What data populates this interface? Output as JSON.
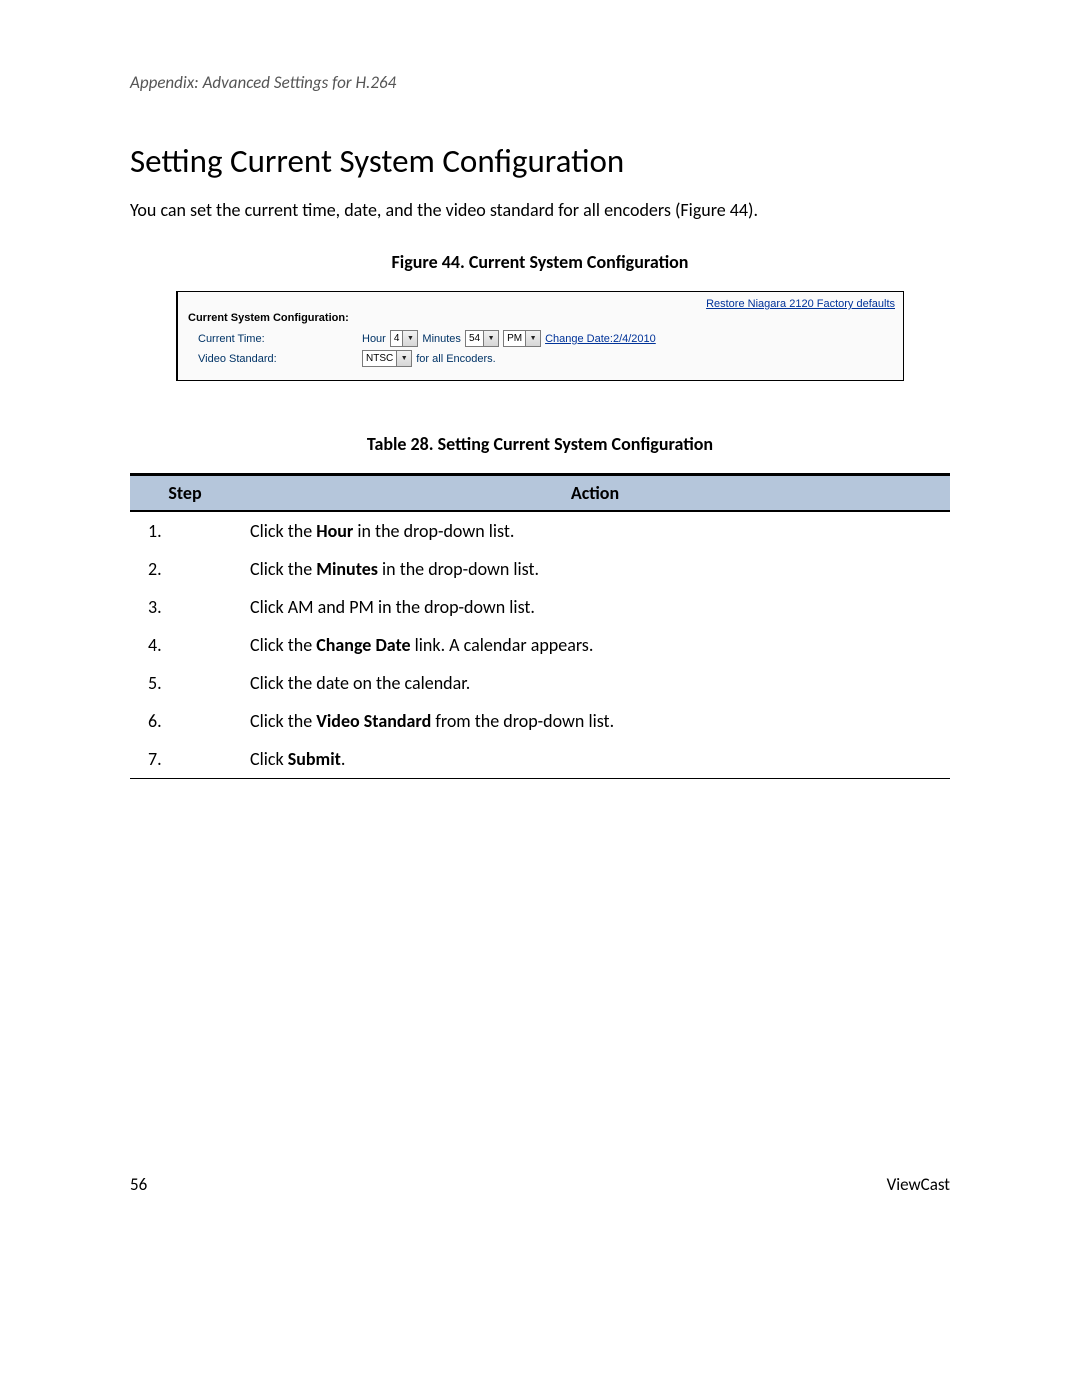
{
  "appendix": "Appendix: Advanced Settings for H.264",
  "heading": "Setting Current System Configuration",
  "intro": "You can set the current time, date, and the video standard for all encoders (Figure 44).",
  "figure_caption": "Figure 44. Current System Configuration",
  "shot": {
    "restore_link": "Restore Niagara 2120 Factory defaults",
    "panel_title": "Current System Configuration:",
    "current_time_label": "Current Time:",
    "video_standard_label": "Video Standard:",
    "hour_prefix": "Hour",
    "hour_value": "4",
    "minutes_prefix": "Minutes",
    "minutes_value": "54",
    "ampm_value": "PM",
    "change_date_prefix": "Change Date:",
    "change_date_value": "2/4/2010",
    "ntsc_value": "NTSC",
    "for_all": " for all Encoders."
  },
  "table_caption": "Table 28. Setting Current System Configuration",
  "table": {
    "head_step": "Step",
    "head_action": "Action",
    "rows": [
      {
        "n": "1.",
        "pre": "Click the ",
        "bold": "Hour",
        "post": " in the drop-down list."
      },
      {
        "n": "2.",
        "pre": "Click the ",
        "bold": "Minutes",
        "post": " in the drop-down list."
      },
      {
        "n": "3.",
        "pre": "Click AM and PM in the drop-down list.",
        "bold": "",
        "post": ""
      },
      {
        "n": "4.",
        "pre": "Click the ",
        "bold": "Change Date",
        "post": " link. A calendar appears."
      },
      {
        "n": "5.",
        "pre": "Click the date on the calendar.",
        "bold": "",
        "post": ""
      },
      {
        "n": "6.",
        "pre": "Click the ",
        "bold": "Video Standard",
        "post": " from the drop-down list."
      },
      {
        "n": "7.",
        "pre": "Click ",
        "bold": "Submit",
        "post": "."
      }
    ]
  },
  "footer": {
    "page": "56",
    "brand": "ViewCast"
  }
}
